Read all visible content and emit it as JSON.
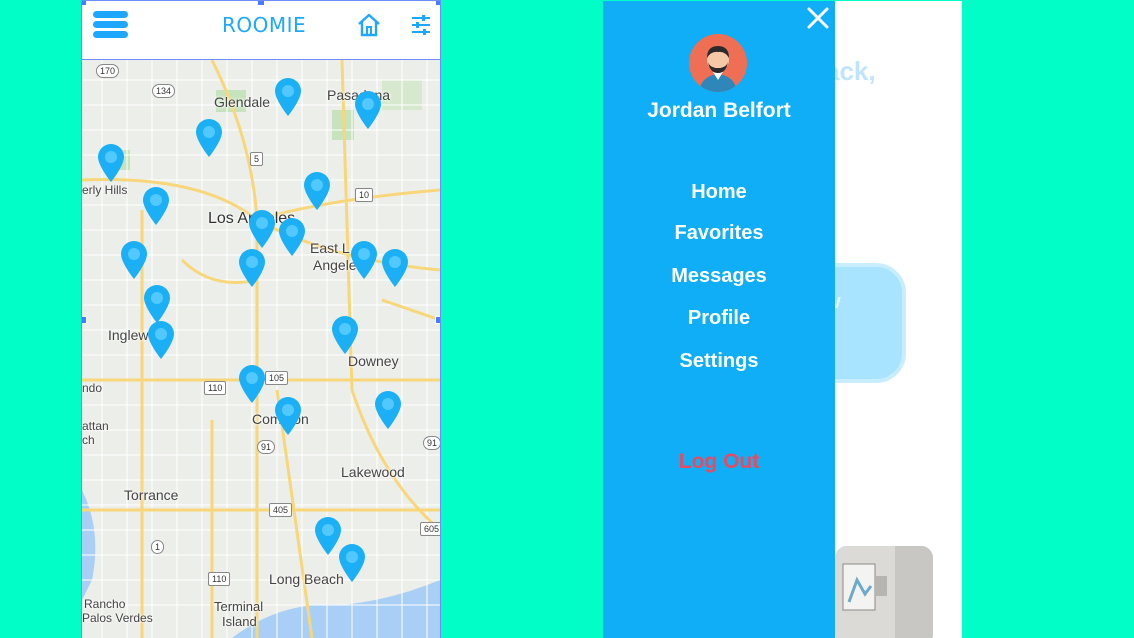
{
  "app": {
    "brand": "ROOMIE"
  },
  "map": {
    "labels": {
      "glendale": "Glendale",
      "pasadena": "Pasadena",
      "beverly_hills": "erly Hills",
      "los_angeles": "Los Angeles",
      "east_la": "East L",
      "angeles_part": "Angele",
      "inglewood": "Inglew",
      "downey": "Downey",
      "ndo": "ndo",
      "compton": "Compton",
      "attan": "attan",
      "ch": "ch",
      "lakewood": "Lakewood",
      "torrance": "Torrance",
      "long_beach": "Long Beach",
      "rancho": "Rancho",
      "palos_verdes": "Palos Verdes",
      "terminal": "Terminal",
      "island": "Island"
    },
    "shields": {
      "r170": "170",
      "r134": "134",
      "r5": "5",
      "r10": "10",
      "r110a": "110",
      "r105": "105",
      "r91a": "91",
      "r91b": "91",
      "r405": "405",
      "r605": "605",
      "r1": "1",
      "r110b": "110"
    },
    "pin_color": "#1bb0f5"
  },
  "menu": {
    "user_name": "Jordan Belfort",
    "items": [
      "Home",
      "Favorites",
      "Messages",
      "Profile",
      "Settings"
    ],
    "logout": "Log Out",
    "background_color": "#0faef7",
    "logout_color": "#e84a5f"
  },
  "background_page": {
    "heading_fragment": "ack,",
    "button_fragment": "w"
  }
}
